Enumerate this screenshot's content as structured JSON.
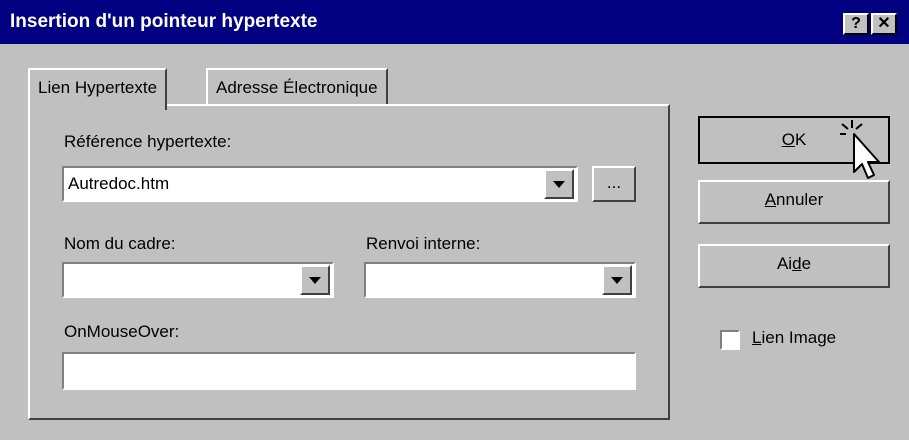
{
  "window": {
    "title": "Insertion d'un pointeur hypertexte",
    "help_button": "?",
    "close_button": "✕"
  },
  "tabs": [
    {
      "label": "Lien Hypertexte",
      "active": true
    },
    {
      "label": "Adresse Électronique",
      "active": false
    }
  ],
  "form": {
    "reference_label": "Référence hypertexte:",
    "reference_value": "Autredoc.htm",
    "browse_button": "...",
    "frame_label": "Nom du cadre:",
    "frame_value": "",
    "anchor_label": "Renvoi interne:",
    "anchor_value": "",
    "onmouseover_label": "OnMouseOver:",
    "onmouseover_value": ""
  },
  "buttons": {
    "ok": {
      "accel": "O",
      "rest": "K"
    },
    "cancel": {
      "accel": "A",
      "rest": "nnuler"
    },
    "help": {
      "pre": "Ai",
      "accel": "d",
      "rest": "e"
    }
  },
  "image_link": {
    "accel": "L",
    "rest": "ien Image",
    "checked": false
  },
  "colors": {
    "titlebar": "#000080",
    "face": "#c0c0c0"
  }
}
